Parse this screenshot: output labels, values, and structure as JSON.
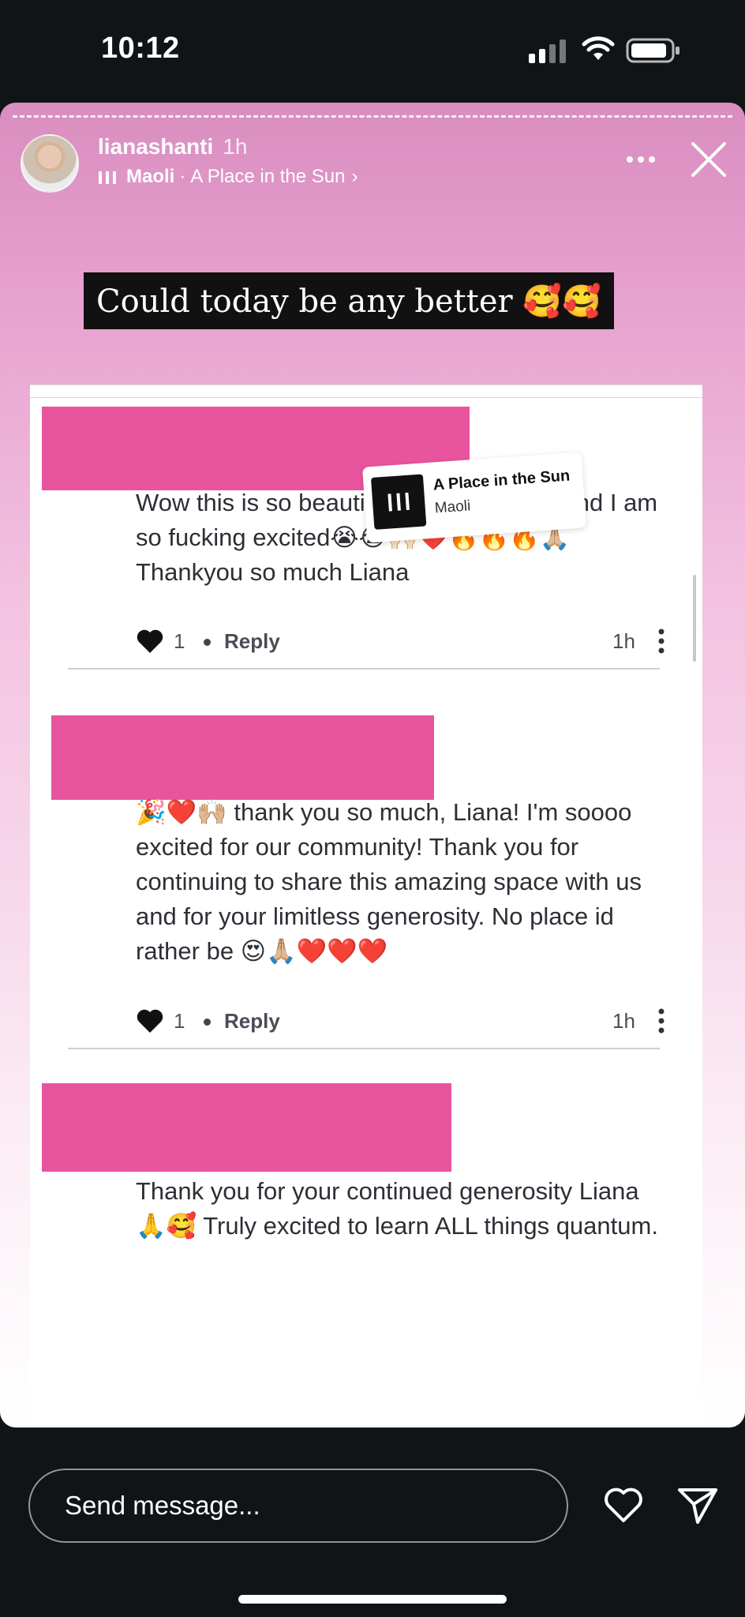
{
  "status_bar": {
    "time": "10:12"
  },
  "story": {
    "username": "lianashanti",
    "posted_time": "1h",
    "music": {
      "artist": "Maoli",
      "separator": "·",
      "song": "A Place in the Sun",
      "chevron": "›"
    },
    "caption": "Could today be any better 🥰🥰",
    "music_sticker": {
      "title": "A Place in the Sun",
      "artist": "Maoli"
    }
  },
  "comments": [
    {
      "text": "Wow this is so beautiful and expansive and I am so fucking excited😭😭🙌🏻❤️🔥🔥🔥🙏🏼 Thankyou so much Liana",
      "likes": "1",
      "reply_label": "Reply",
      "time": "1h"
    },
    {
      "text": "🎉❤️🙌🏼 thank you so much, Liana! I'm soooo excited for our community! Thank you for continuing to share this amazing space with us and for your limitless generosity. No place id rather be 😍🙏🏼❤️❤️❤️",
      "likes": "1",
      "reply_label": "Reply",
      "time": "1h"
    },
    {
      "text": "Thank you for your continued generosity Liana 🙏🥰 Truly excited to learn ALL things quantum."
    }
  ],
  "bottom_bar": {
    "message_placeholder": "Send message..."
  },
  "colors": {
    "redaction": "#e8559e",
    "caption_bg": "#111111"
  },
  "icons": [
    "signal-icon",
    "wifi-icon",
    "battery-icon",
    "music-bars-icon",
    "more-options-icon",
    "close-icon",
    "heart-icon",
    "kebab-menu-icon",
    "like-heart-icon",
    "send-icon"
  ]
}
